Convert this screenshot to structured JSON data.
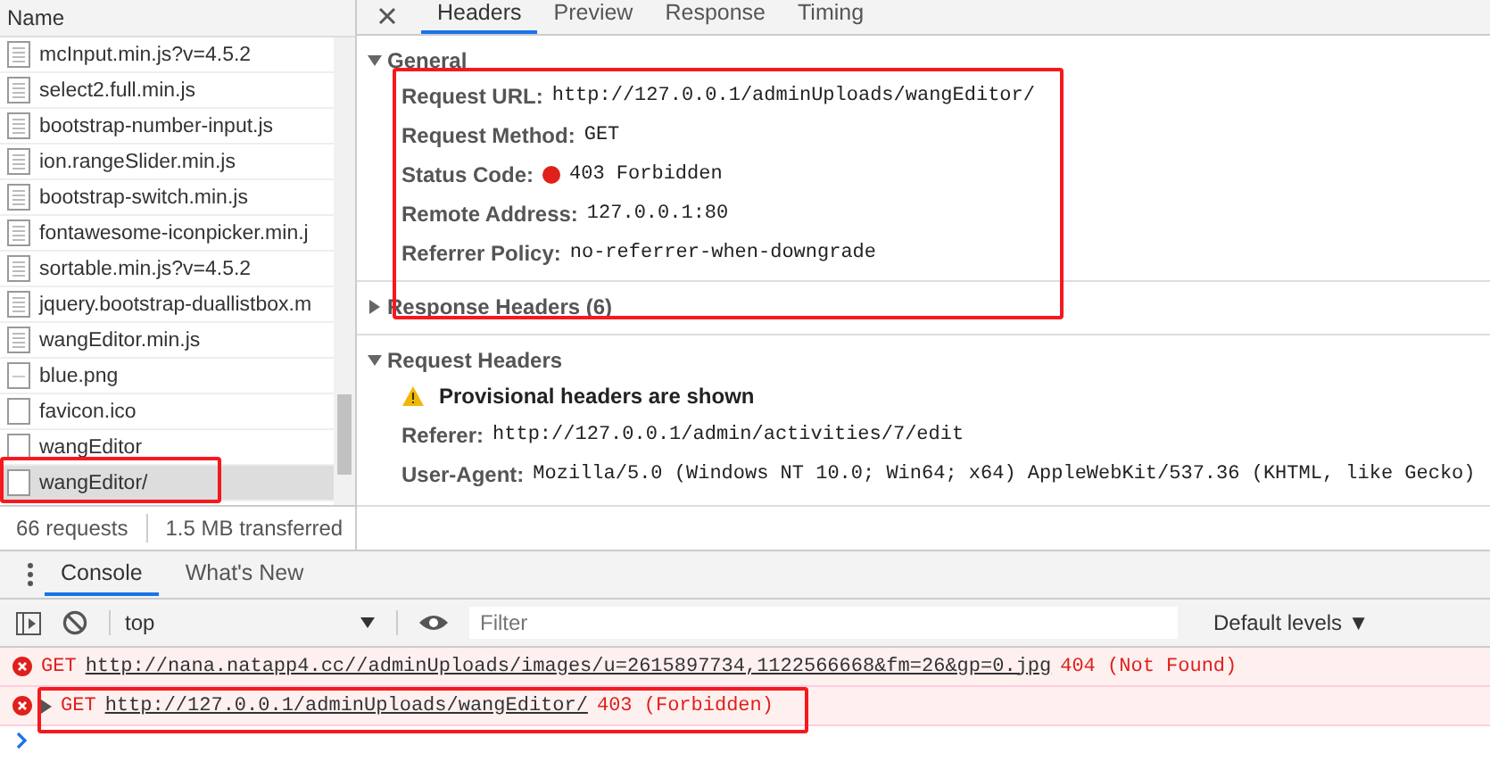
{
  "network": {
    "name_header": "Name",
    "files": [
      {
        "name": "mcInput.min.js?v=4.5.2",
        "kind": "script",
        "selected": false
      },
      {
        "name": "select2.full.min.js",
        "kind": "script",
        "selected": false
      },
      {
        "name": "bootstrap-number-input.js",
        "kind": "script",
        "selected": false
      },
      {
        "name": "ion.rangeSlider.min.js",
        "kind": "script",
        "selected": false
      },
      {
        "name": "bootstrap-switch.min.js",
        "kind": "script",
        "selected": false
      },
      {
        "name": "fontawesome-iconpicker.min.j",
        "kind": "script",
        "selected": false
      },
      {
        "name": "sortable.min.js?v=4.5.2",
        "kind": "script",
        "selected": false
      },
      {
        "name": "jquery.bootstrap-duallistbox.m",
        "kind": "script",
        "selected": false
      },
      {
        "name": "wangEditor.min.js",
        "kind": "script",
        "selected": false
      },
      {
        "name": "blue.png",
        "kind": "image",
        "selected": false
      },
      {
        "name": "favicon.ico",
        "kind": "doc",
        "selected": false
      },
      {
        "name": "wangEditor",
        "kind": "doc",
        "selected": false
      },
      {
        "name": "wangEditor/",
        "kind": "doc",
        "selected": true
      }
    ],
    "requests": "66 requests",
    "transferred": "1.5 MB transferred"
  },
  "details": {
    "tabs": [
      {
        "label": "Headers",
        "selected": true
      },
      {
        "label": "Preview",
        "selected": false
      },
      {
        "label": "Response",
        "selected": false
      },
      {
        "label": "Timing",
        "selected": false
      }
    ],
    "sections": [
      {
        "title": "General",
        "expanded": true,
        "rows": [
          {
            "label": "Request URL:",
            "value": "http://127.0.0.1/adminUploads/wangEditor/",
            "kind": "text"
          },
          {
            "label": "Request Method:",
            "value": "GET",
            "kind": "text"
          },
          {
            "label": "Status Code:",
            "value": "403 Forbidden",
            "kind": "status"
          },
          {
            "label": "Remote Address:",
            "value": "127.0.0.1:80",
            "kind": "text"
          },
          {
            "label": "Referrer Policy:",
            "value": "no-referrer-when-downgrade",
            "kind": "text"
          }
        ]
      },
      {
        "title": "Response Headers (6)",
        "expanded": false
      },
      {
        "title": "Request Headers",
        "expanded": true,
        "warning": "Provisional headers are shown",
        "rows": [
          {
            "label": "Referer:",
            "value": "http://127.0.0.1/admin/activities/7/edit",
            "kind": "text"
          },
          {
            "label": "User-Agent:",
            "value": "Mozilla/5.0 (Windows NT 10.0; Win64; x64) AppleWebKit/537.36 (KHTML, like Gecko)",
            "kind": "text"
          }
        ]
      }
    ]
  },
  "console": {
    "tabs": [
      {
        "label": "Console",
        "selected": true
      },
      {
        "label": "What's New",
        "selected": false
      }
    ],
    "context": "top",
    "filter_placeholder": "Filter",
    "levels": "Default levels ▼",
    "messages": [
      {
        "kind": "plain",
        "method": "GET",
        "url": "http://nana.natapp4.cc//adminUploads/images/u=2615897734,1122566668&fm=26&gp=0.jpg",
        "status": "404 (Not Found)"
      },
      {
        "kind": "group",
        "method": "GET",
        "url": "http://127.0.0.1/adminUploads/wangEditor/",
        "status": "403 (Forbidden)"
      }
    ]
  }
}
